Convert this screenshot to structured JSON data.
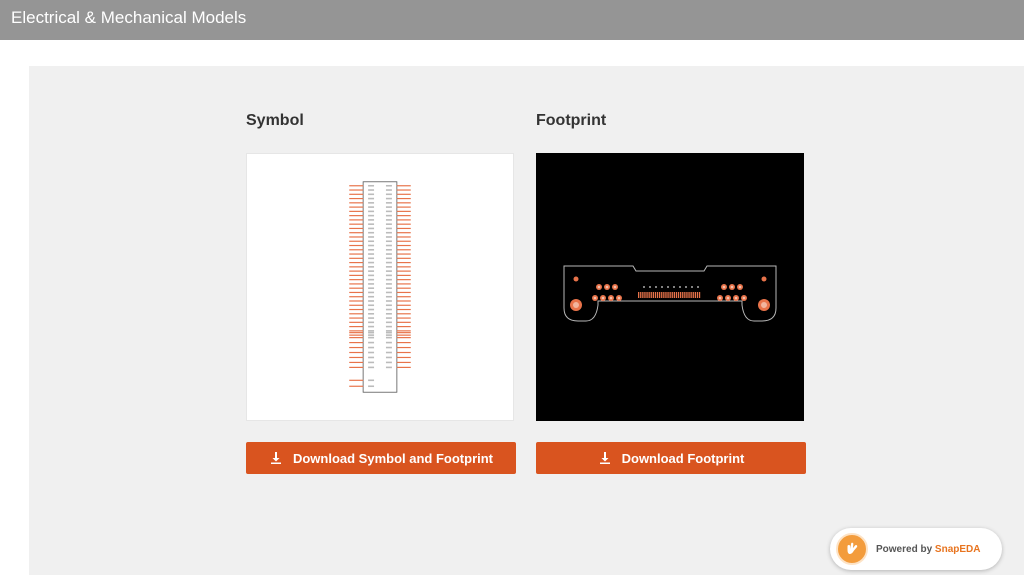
{
  "header": {
    "title": "Electrical & Mechanical Models"
  },
  "symbol": {
    "title": "Symbol",
    "download_label": "Download Symbol and Footprint"
  },
  "footprint": {
    "title": "Footprint",
    "download_label": "Download Footprint"
  },
  "badge": {
    "prefix": "Powered by",
    "brand": "SnapEDA"
  },
  "colors": {
    "accent": "#d9541f",
    "header_bg": "#959595",
    "panel_bg": "#f0f0f0",
    "pad": "#e8734a"
  },
  "icons": {
    "download": "download-icon",
    "badge_logo": "snapeda-hand-icon"
  }
}
